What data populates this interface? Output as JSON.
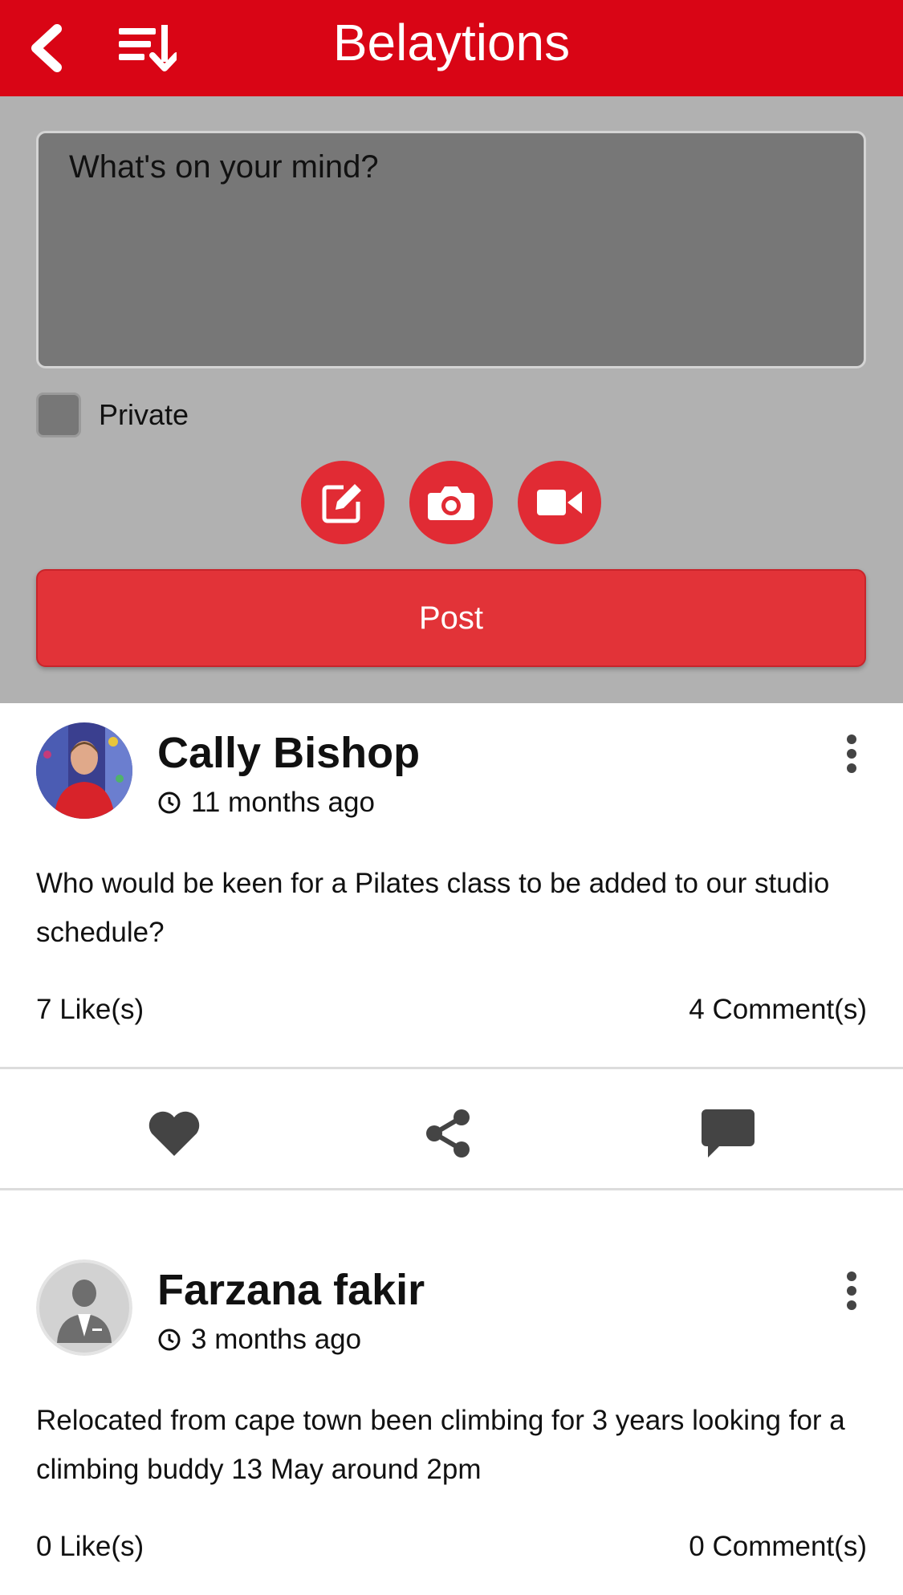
{
  "header": {
    "title": "Belaytions",
    "back_icon": "chevron-left-icon",
    "sort_icon": "sort-descending-icon",
    "background": "#d90515"
  },
  "composer": {
    "placeholder": "What's on your mind?",
    "private_label": "Private",
    "private_checked": false,
    "media_buttons": [
      "edit-icon",
      "camera-icon",
      "video-icon"
    ],
    "post_label": "Post",
    "accent": "#e23338"
  },
  "posts": [
    {
      "author": "Cally Bishop",
      "time": "11 months ago",
      "text": "Who would be keen for a Pilates class to be added to our studio schedule?",
      "likes": "7 Like(s)",
      "comments": "4 Comment(s)",
      "actions": [
        "heart-icon",
        "share-icon",
        "comment-icon"
      ]
    },
    {
      "author": "Farzana fakir",
      "time": "3 months ago",
      "text": "Relocated from cape town been climbing for 3 years looking for a climbing buddy 13 May around 2pm",
      "likes": "0 Like(s)",
      "comments": "0 Comment(s)"
    }
  ]
}
